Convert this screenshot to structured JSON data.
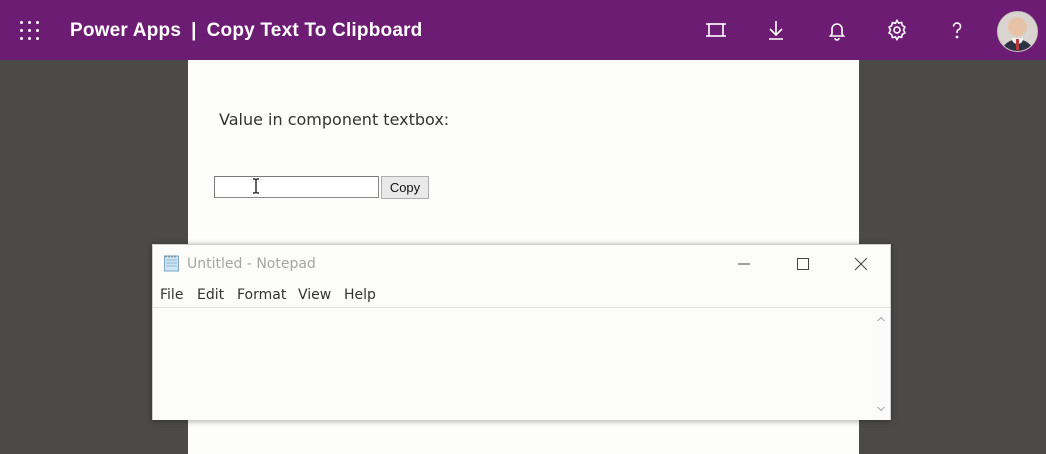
{
  "header": {
    "app_name": "Power Apps",
    "separator": "|",
    "app_title": "Copy Text To Clipboard",
    "background_color": "#6d1c73",
    "icons": [
      "waffle-icon",
      "fit-to-window-icon",
      "download-icon",
      "bell-icon",
      "gear-icon",
      "help-icon",
      "avatar"
    ]
  },
  "canvas": {
    "label": "Value in component textbox:",
    "textbox_value": "",
    "copy_button_label": "Copy"
  },
  "notepad": {
    "title": "Untitled - Notepad",
    "menu": [
      "File",
      "Edit",
      "Format",
      "View",
      "Help"
    ],
    "content": ""
  }
}
